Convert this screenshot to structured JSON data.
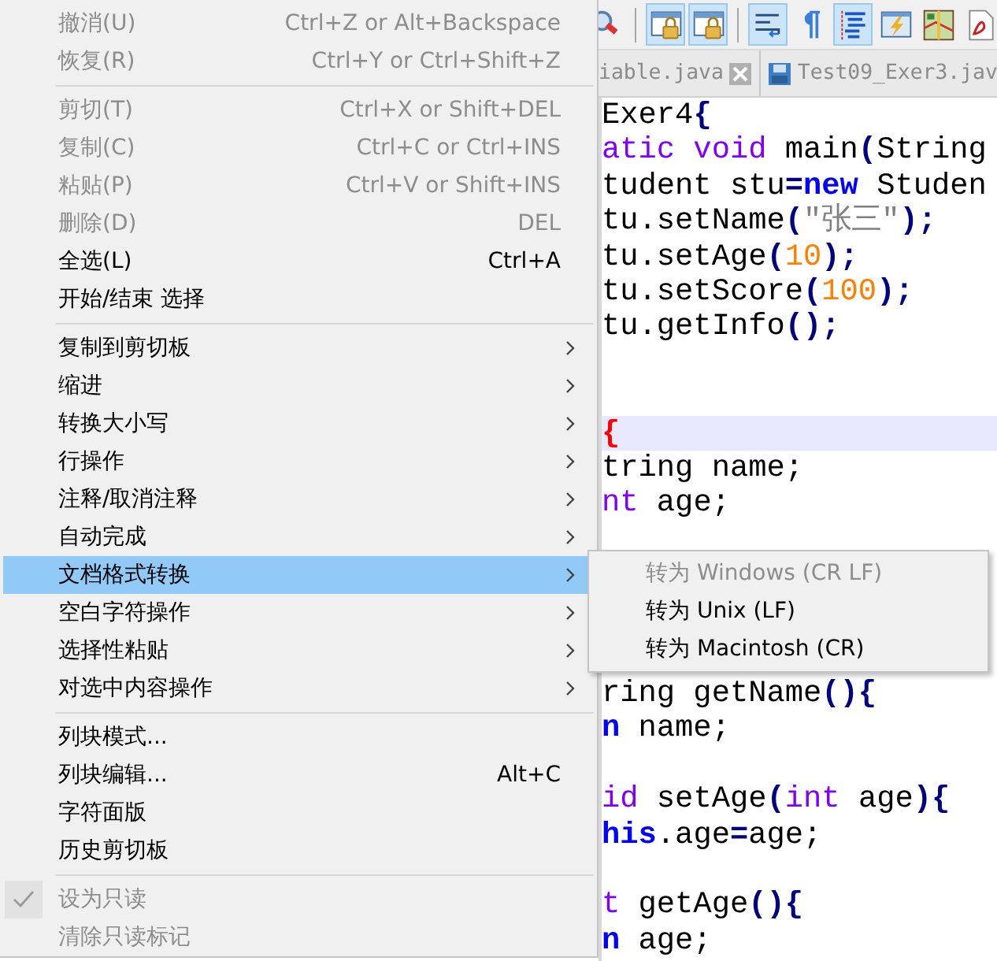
{
  "context_menu": {
    "items": [
      {
        "kind": "item",
        "label": "撤消(U)",
        "shortcut": "Ctrl+Z or Alt+Backspace",
        "disabled": true,
        "submenu": false,
        "selected": false,
        "checked": false
      },
      {
        "kind": "item",
        "label": "恢复(R)",
        "shortcut": "Ctrl+Y or Ctrl+Shift+Z",
        "disabled": true,
        "submenu": false,
        "selected": false,
        "checked": false
      },
      {
        "kind": "separator"
      },
      {
        "kind": "item",
        "label": "剪切(T)",
        "shortcut": "Ctrl+X or Shift+DEL",
        "disabled": true,
        "submenu": false,
        "selected": false,
        "checked": false
      },
      {
        "kind": "item",
        "label": "复制(C)",
        "shortcut": "Ctrl+C or Ctrl+INS",
        "disabled": true,
        "submenu": false,
        "selected": false,
        "checked": false
      },
      {
        "kind": "item",
        "label": "粘贴(P)",
        "shortcut": "Ctrl+V or Shift+INS",
        "disabled": true,
        "submenu": false,
        "selected": false,
        "checked": false
      },
      {
        "kind": "item",
        "label": "删除(D)",
        "shortcut": "DEL",
        "disabled": true,
        "submenu": false,
        "selected": false,
        "checked": false
      },
      {
        "kind": "item",
        "label": "全选(L)",
        "shortcut": "Ctrl+A",
        "disabled": false,
        "submenu": false,
        "selected": false,
        "checked": false
      },
      {
        "kind": "item",
        "label": "开始/结束 选择",
        "disabled": false,
        "submenu": false,
        "selected": false,
        "checked": false
      },
      {
        "kind": "separator"
      },
      {
        "kind": "item",
        "label": "复制到剪切板",
        "disabled": false,
        "submenu": true,
        "selected": false,
        "checked": false
      },
      {
        "kind": "item",
        "label": "缩进",
        "disabled": false,
        "submenu": true,
        "selected": false,
        "checked": false
      },
      {
        "kind": "item",
        "label": "转换大小写",
        "disabled": false,
        "submenu": true,
        "selected": false,
        "checked": false
      },
      {
        "kind": "item",
        "label": "行操作",
        "disabled": false,
        "submenu": true,
        "selected": false,
        "checked": false
      },
      {
        "kind": "item",
        "label": "注释/取消注释",
        "disabled": false,
        "submenu": true,
        "selected": false,
        "checked": false
      },
      {
        "kind": "item",
        "label": "自动完成",
        "disabled": false,
        "submenu": true,
        "selected": false,
        "checked": false
      },
      {
        "kind": "item",
        "label": "文档格式转换",
        "disabled": false,
        "submenu": true,
        "selected": true,
        "checked": false,
        "submenu_items": [
          {
            "label": "转为 Windows (CR LF)",
            "disabled": true
          },
          {
            "label": "转为 Unix (LF)",
            "disabled": false
          },
          {
            "label": "转为 Macintosh (CR)",
            "disabled": false
          }
        ]
      },
      {
        "kind": "item",
        "label": "空白字符操作",
        "disabled": false,
        "submenu": true,
        "selected": false,
        "checked": false
      },
      {
        "kind": "item",
        "label": "选择性粘贴",
        "disabled": false,
        "submenu": true,
        "selected": false,
        "checked": false
      },
      {
        "kind": "item",
        "label": "对选中内容操作",
        "disabled": false,
        "submenu": true,
        "selected": false,
        "checked": false
      },
      {
        "kind": "separator"
      },
      {
        "kind": "item",
        "label": "列块模式...",
        "disabled": false,
        "submenu": false,
        "selected": false,
        "checked": false
      },
      {
        "kind": "item",
        "label": "列块编辑...",
        "shortcut": "Alt+C",
        "disabled": false,
        "submenu": false,
        "selected": false,
        "checked": false
      },
      {
        "kind": "item",
        "label": "字符面版",
        "disabled": false,
        "submenu": false,
        "selected": false,
        "checked": false
      },
      {
        "kind": "item",
        "label": "历史剪切板",
        "disabled": false,
        "submenu": false,
        "selected": false,
        "checked": false
      },
      {
        "kind": "separator"
      },
      {
        "kind": "item",
        "label": "设为只读",
        "disabled": true,
        "submenu": false,
        "selected": false,
        "checked": true
      },
      {
        "kind": "item",
        "label": "清除只读标记",
        "disabled": true,
        "submenu": false,
        "selected": false,
        "checked": false
      }
    ]
  },
  "toolbar": {
    "buttons": [
      {
        "kind": "zoom",
        "pressed": false
      },
      {
        "kind": "separator"
      },
      {
        "kind": "lock-window",
        "pressed": true
      },
      {
        "kind": "lock-window",
        "pressed": true
      },
      {
        "kind": "separator"
      },
      {
        "kind": "wrap",
        "pressed": true
      },
      {
        "kind": "pilcrow",
        "pressed": false
      },
      {
        "kind": "indent-guide",
        "pressed": true
      },
      {
        "kind": "flash-window",
        "pressed": false
      },
      {
        "kind": "map",
        "pressed": false
      },
      {
        "kind": "document",
        "pressed": false
      }
    ]
  },
  "tabs": [
    {
      "label": "iable.java",
      "selected": false,
      "closable": true,
      "saved_icon": false
    },
    {
      "label": "Test09_Exer3.jav",
      "selected": false,
      "closable": false,
      "saved_icon": true
    }
  ],
  "editor": {
    "lines": [
      {
        "current": false,
        "tokens": [
          {
            "text": "Exer4",
            "kind": "plain"
          },
          {
            "text": "{",
            "kind": "brace"
          }
        ]
      },
      {
        "current": false,
        "tokens": [
          {
            "text": "atic void",
            "kind": "type"
          },
          {
            "text": " main",
            "kind": "plain"
          },
          {
            "text": "(",
            "kind": "brace"
          },
          {
            "text": "String",
            "kind": "plain"
          }
        ]
      },
      {
        "current": false,
        "tokens": [
          {
            "text": "tudent stu",
            "kind": "plain"
          },
          {
            "text": "=",
            "kind": "op"
          },
          {
            "text": "new",
            "kind": "keyword"
          },
          {
            "text": " Studen",
            "kind": "plain"
          }
        ]
      },
      {
        "current": false,
        "tokens": [
          {
            "text": "tu.setName",
            "kind": "plain"
          },
          {
            "text": "(",
            "kind": "brace"
          },
          {
            "text": "\"张三\"",
            "kind": "string"
          },
          {
            "text": ");",
            "kind": "brace"
          }
        ]
      },
      {
        "current": false,
        "tokens": [
          {
            "text": "tu.setAge",
            "kind": "plain"
          },
          {
            "text": "(",
            "kind": "brace"
          },
          {
            "text": "10",
            "kind": "number"
          },
          {
            "text": ");",
            "kind": "brace"
          }
        ]
      },
      {
        "current": false,
        "tokens": [
          {
            "text": "tu.setScore",
            "kind": "plain"
          },
          {
            "text": "(",
            "kind": "brace"
          },
          {
            "text": "100",
            "kind": "number"
          },
          {
            "text": ");",
            "kind": "brace"
          }
        ]
      },
      {
        "current": false,
        "tokens": [
          {
            "text": "tu.getInfo",
            "kind": "plain"
          },
          {
            "text": "();",
            "kind": "brace"
          }
        ]
      },
      {
        "current": false
      },
      {
        "current": false
      },
      {
        "current": true,
        "tokens": [
          {
            "text": "{",
            "kind": "match"
          }
        ]
      },
      {
        "current": false,
        "tokens": [
          {
            "text": "tring name;",
            "kind": "plain"
          }
        ]
      },
      {
        "current": false,
        "tokens": [
          {
            "text": "nt",
            "kind": "type"
          },
          {
            "text": " age;",
            "kind": "plain"
          }
        ]
      },
      {
        "current": false
      },
      {
        "current": false
      },
      {
        "current": false
      },
      {
        "current": false
      },
      {
        "current": false,
        "tokens": [
          {
            "text": "ring getName",
            "kind": "plain"
          },
          {
            "text": "(){",
            "kind": "brace"
          }
        ]
      },
      {
        "current": false,
        "tokens": [
          {
            "text": "n",
            "kind": "keyword"
          },
          {
            "text": " name;",
            "kind": "plain"
          }
        ]
      },
      {
        "current": false
      },
      {
        "current": false,
        "tokens": [
          {
            "text": "id",
            "kind": "type"
          },
          {
            "text": " setAge",
            "kind": "plain"
          },
          {
            "text": "(",
            "kind": "brace"
          },
          {
            "text": "int",
            "kind": "type"
          },
          {
            "text": " age",
            "kind": "plain"
          },
          {
            "text": "){",
            "kind": "brace"
          }
        ]
      },
      {
        "current": false,
        "tokens": [
          {
            "text": "his",
            "kind": "keyword"
          },
          {
            "text": ".age",
            "kind": "plain"
          },
          {
            "text": "=",
            "kind": "op"
          },
          {
            "text": "age;",
            "kind": "plain"
          }
        ]
      },
      {
        "current": false
      },
      {
        "current": false,
        "tokens": [
          {
            "text": "t",
            "kind": "type"
          },
          {
            "text": " getAge",
            "kind": "plain"
          },
          {
            "text": "(){",
            "kind": "brace"
          }
        ]
      },
      {
        "current": false,
        "tokens": [
          {
            "text": "n",
            "kind": "keyword"
          },
          {
            "text": " age;",
            "kind": "plain"
          }
        ]
      }
    ]
  }
}
